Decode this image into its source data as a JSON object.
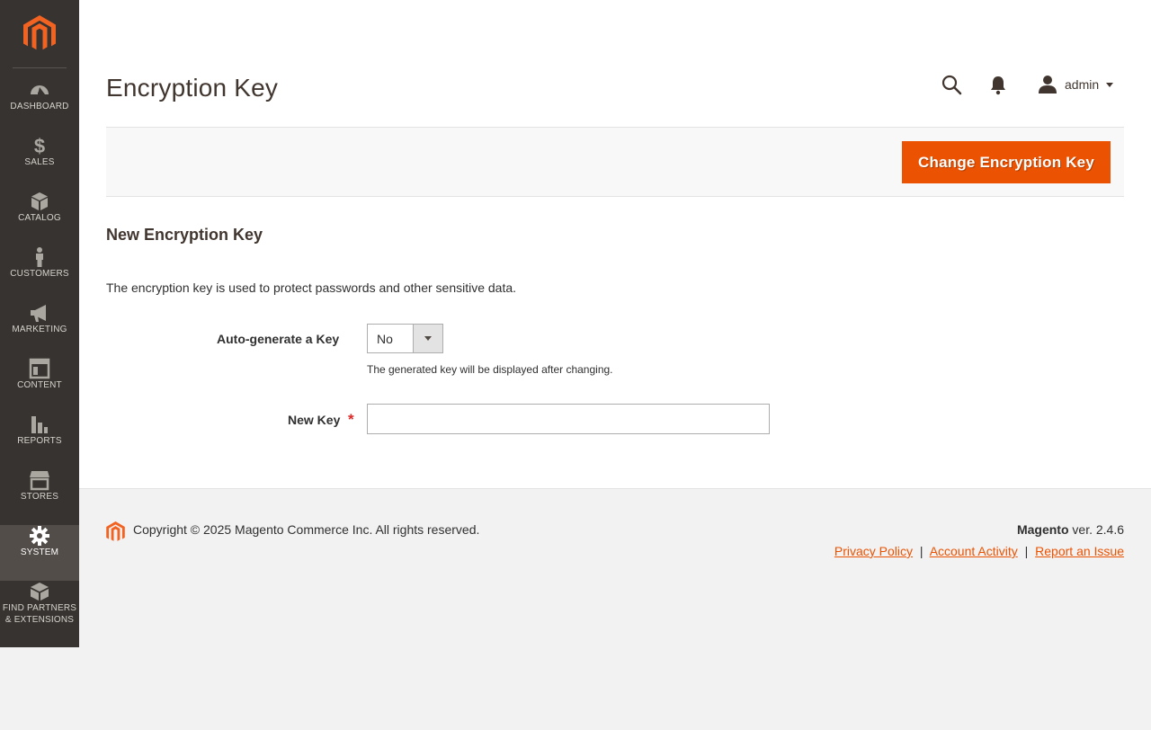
{
  "sidebar": {
    "items": [
      {
        "label": "DASHBOARD",
        "icon": "dashboard-icon"
      },
      {
        "label": "SALES",
        "icon": "dollar-icon"
      },
      {
        "label": "CATALOG",
        "icon": "cube-icon"
      },
      {
        "label": "CUSTOMERS",
        "icon": "person-icon"
      },
      {
        "label": "MARKETING",
        "icon": "megaphone-icon"
      },
      {
        "label": "CONTENT",
        "icon": "layout-icon"
      },
      {
        "label": "REPORTS",
        "icon": "bar-chart-icon"
      },
      {
        "label": "STORES",
        "icon": "store-icon"
      },
      {
        "label": "SYSTEM",
        "icon": "gear-icon",
        "active": true
      },
      {
        "label_line1": "FIND PARTNERS",
        "label_line2": "& EXTENSIONS",
        "icon": "blocks-icon"
      }
    ]
  },
  "header": {
    "title": "Encryption Key",
    "user": "admin"
  },
  "action_bar": {
    "primary_button": "Change Encryption Key"
  },
  "form": {
    "section_title": "New Encryption Key",
    "description": "The encryption key is used to protect passwords and other sensitive data.",
    "auto_generate": {
      "label": "Auto-generate a Key",
      "value": "No",
      "note": "The generated key will be displayed after changing."
    },
    "new_key": {
      "label": "New Key",
      "required_mark": "*",
      "value": ""
    }
  },
  "footer": {
    "copyright": "Copyright © 2025 Magento Commerce Inc. All rights reserved.",
    "brand": "Magento",
    "version": " ver. 2.4.6",
    "links": [
      "Privacy Policy",
      "Account Activity",
      "Report an Issue"
    ],
    "separator": "|"
  },
  "colors": {
    "accent": "#eb5202",
    "sidebar_bg": "#373330",
    "sidebar_active": "#524d49"
  }
}
